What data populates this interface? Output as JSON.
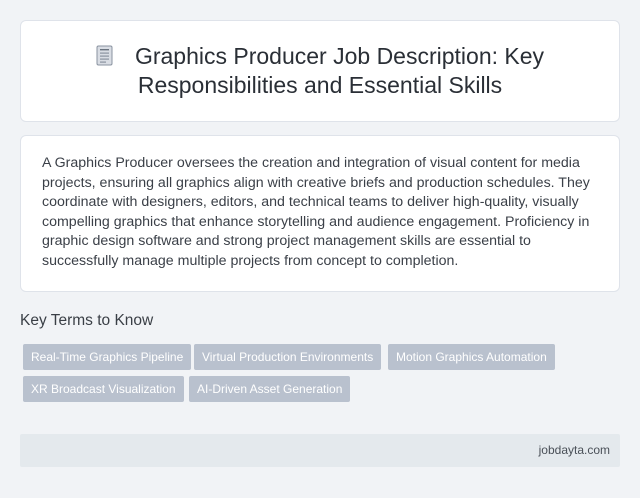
{
  "header": {
    "title": "Graphics Producer Job Description: Key Responsibilities and Essential Skills",
    "icon": "document-icon"
  },
  "description": {
    "text": "A Graphics Producer oversees the creation and integration of visual content for media projects, ensuring all graphics align with creative briefs and production schedules. They coordinate with designers, editors, and technical teams to deliver high-quality, visually compelling graphics that enhance storytelling and audience engagement. Proficiency in graphic design software and strong project management skills are essential to successfully manage multiple projects from concept to completion."
  },
  "key_terms": {
    "heading": "Key Terms to Know",
    "tags": [
      "Real-Time Graphics Pipeline",
      "Virtual Production Environments",
      "Motion Graphics Automation",
      "XR Broadcast Visualization",
      "AI-Driven Asset Generation"
    ]
  },
  "footer": {
    "site": "jobdayta.com"
  },
  "colors": {
    "background": "#f1f3f6",
    "card": "#ffffff",
    "tag": "#b9c1ce",
    "footer": "#e4e9ed"
  }
}
